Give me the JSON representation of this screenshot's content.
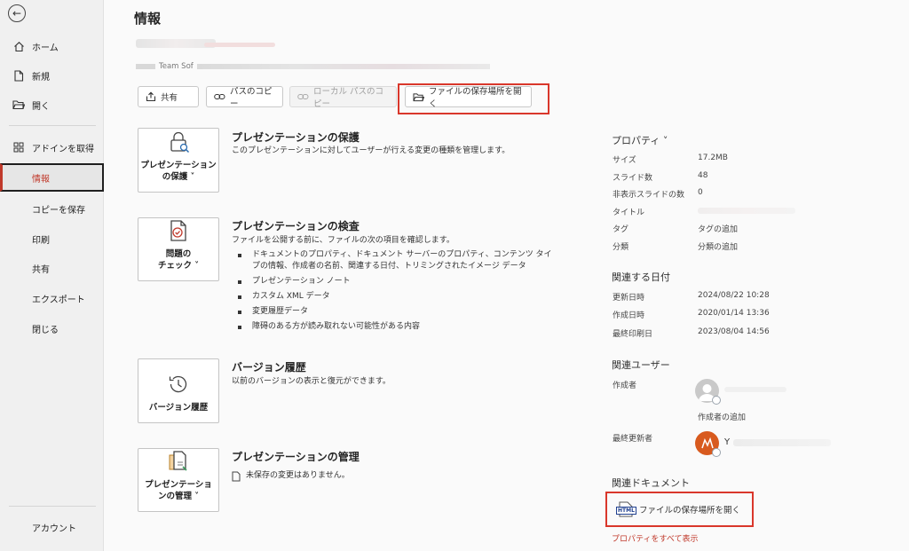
{
  "sidebar": {
    "back_icon": "back-arrow-icon",
    "items": [
      {
        "label": "ホーム",
        "icon": "home-icon"
      },
      {
        "label": "新規",
        "icon": "new-file-icon"
      },
      {
        "label": "開く",
        "icon": "folder-open-icon"
      },
      {
        "label": "アドインを取得",
        "icon": "grid-icon"
      },
      {
        "label": "情報"
      },
      {
        "label": "コピーを保存"
      },
      {
        "label": "印刷"
      },
      {
        "label": "共有"
      },
      {
        "label": "エクスポート"
      },
      {
        "label": "閉じる"
      }
    ],
    "account_label": "アカウント"
  },
  "header": {
    "title": "情報",
    "path_fragment": "Team Sof"
  },
  "toolbar": {
    "share_label": "共有",
    "copy_path_label": "パスのコピー",
    "copy_local_path_label": "ローカル パスのコピー",
    "open_location_label": "ファイルの保存場所を開く"
  },
  "sections": {
    "protect": {
      "card_label_line1": "プレゼンテーション",
      "card_label_line2": "の保護 ˅",
      "title": "プレゼンテーションの保護",
      "desc": "このプレゼンテーションに対してユーザーが行える変更の種類を管理します。"
    },
    "inspect": {
      "card_label_line1": "問題の",
      "card_label_line2": "チェック ˅",
      "title": "プレゼンテーションの検査",
      "desc": "ファイルを公開する前に、ファイルの次の項目を確認します。",
      "bullets": [
        "ドキュメントのプロパティ、ドキュメント サーバーのプロパティ、コンテンツ タイプの情報、作成者の名前、関連する日付、トリミングされたイメージ データ",
        "プレゼンテーション ノート",
        "カスタム XML データ",
        "変更履歴データ",
        "障碍のある方が読み取れない可能性がある内容"
      ]
    },
    "version": {
      "card_label": "バージョン履歴",
      "title": "バージョン履歴",
      "desc": "以前のバージョンの表示と復元ができます。"
    },
    "manage": {
      "card_label_line1": "プレゼンテーショ",
      "card_label_line2": "ンの管理 ˅",
      "title": "プレゼンテーションの管理",
      "desc": "未保存の変更はありません。"
    }
  },
  "properties": {
    "heading": "プロパティ ˅",
    "rows": [
      {
        "key": "サイズ",
        "value": "17.2MB"
      },
      {
        "key": "スライド数",
        "value": "48"
      },
      {
        "key": "非表示スライドの数",
        "value": "0"
      },
      {
        "key": "タイトル",
        "value": ""
      },
      {
        "key": "タグ",
        "value": "タグの追加"
      },
      {
        "key": "分類",
        "value": "分類の追加"
      }
    ]
  },
  "dates": {
    "heading": "関連する日付",
    "rows": [
      {
        "key": "更新日時",
        "value": "2024/08/22 10:28"
      },
      {
        "key": "作成日時",
        "value": "2020/01/14 13:36"
      },
      {
        "key": "最終印刷日",
        "value": "2023/08/04 14:56"
      }
    ]
  },
  "users": {
    "heading": "関連ユーザー",
    "author_label": "作成者",
    "add_author": "作成者の追加",
    "last_modified_label": "最終更新者",
    "last_modified_initial": "Y"
  },
  "documents": {
    "heading": "関連ドキュメント",
    "open_location": "ファイルの保存場所を開く",
    "html_badge": "HTML"
  },
  "show_all_properties": "プロパティをすべて表示",
  "colors": {
    "accent_red": "#d9372b",
    "avatar_orange": "#d85a1e"
  }
}
